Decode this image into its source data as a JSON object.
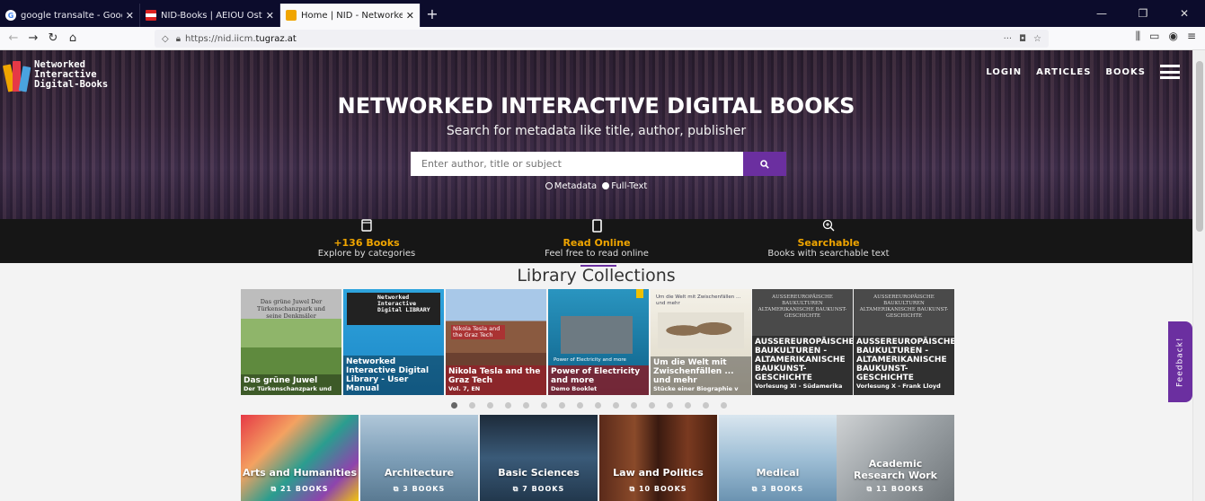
{
  "browser": {
    "tabs": [
      {
        "title": "google transalte - Google Search",
        "favicon": "google-icon",
        "active": false
      },
      {
        "title": "NID-Books | AEIOU Österreich-Lexikon",
        "favicon": "flag-icon",
        "active": false
      },
      {
        "title": "Home | NID - Networked Interactive",
        "favicon": "nid-icon",
        "active": true
      }
    ],
    "new_tab": "+",
    "url_prefix": "https://nid.iicm.",
    "url_domain": "tugraz.at",
    "url_more": "···"
  },
  "site": {
    "logo_lines": [
      "Networked",
      "Interactive",
      "Digital-Books"
    ],
    "nav": {
      "login": "LOGIN",
      "articles": "ARTICLES",
      "books": "BOOKS"
    },
    "hero_title": "NETWORKED INTERACTIVE DIGITAL BOOKS",
    "hero_subtitle": "Search for metadata like title, author, publisher",
    "search": {
      "placeholder": "Enter author, title or subject"
    },
    "radio": {
      "metadata": "Metadata",
      "fulltext": "Full-Text"
    }
  },
  "features": [
    {
      "title": "+136 Books",
      "subtitle": "Explore by categories",
      "icon": "book-icon"
    },
    {
      "title": "Read Online",
      "subtitle": "Feel free to read online",
      "icon": "tablet-icon"
    },
    {
      "title": "Searchable",
      "subtitle": "Books with searchable text",
      "icon": "zoom-icon"
    }
  ],
  "collections_title": "Library Collections",
  "books": [
    {
      "title": "Das grüne Juwel",
      "subtitle": "Der Türkenschanzpark und",
      "cover_text": "Das grüne Juwel Der Türkenschanzpark und seine Denkmäler"
    },
    {
      "title": "Networked Interactive Digital Library - User Manual",
      "subtitle": "",
      "cover_text": "Networked Interactive Digital LIBRARY"
    },
    {
      "title": "Nikola Tesla and the Graz Tech",
      "subtitle": "Vol. 7, EN",
      "cover_text": "Nikola Tesla and the Graz Tech"
    },
    {
      "title": "Power of Electricity and more",
      "subtitle": "Demo Booklet",
      "cover_text": "Power of Electricity and more"
    },
    {
      "title": "Um die Welt mit Zwischenfällen ... und mehr",
      "subtitle": "Stücke einer Biographie v",
      "cover_text": "Um die Welt mit Zwischenfällen ... und mehr"
    },
    {
      "title": "AUSSEREUROPÄISCHE BAUKULTUREN - ALTAMERIKANISCHE BAUKUNST-GESCHICHTE",
      "subtitle": "Vorlesung XI - Südamerika",
      "cover_text": "AUSSEREUROPÄISCHE BAUKULTUREN ALTAMERIKANISCHE BAUKUNST-GESCHICHTE"
    },
    {
      "title": "AUSSEREUROPÄISCHE BAUKULTUREN - ALTAMERIKANISCHE BAUKUNST-GESCHICHTE",
      "subtitle": "Vorlesung X - Frank Lloyd",
      "cover_text": "AUSSEREUROPÄISCHE BAUKULTUREN ALTAMERIKANISCHE BAUKUNST-GESCHICHTE"
    }
  ],
  "carousel": {
    "dot_count": 16,
    "active_index": 0
  },
  "categories": [
    {
      "name": "Arts and Humanities",
      "count": "21 BOOKS"
    },
    {
      "name": "Architecture",
      "count": "3 BOOKS"
    },
    {
      "name": "Basic Sciences",
      "count": "7 BOOKS"
    },
    {
      "name": "Law and Politics",
      "count": "10 BOOKS"
    },
    {
      "name": "Medical",
      "count": "3 BOOKS"
    },
    {
      "name": "Academic Research Work",
      "count": "11 BOOKS"
    }
  ],
  "feedback": "Feedback!",
  "colors": {
    "accent": "#6b2fa0",
    "feature_highlight": "#f0a500",
    "strip": "#161616"
  }
}
